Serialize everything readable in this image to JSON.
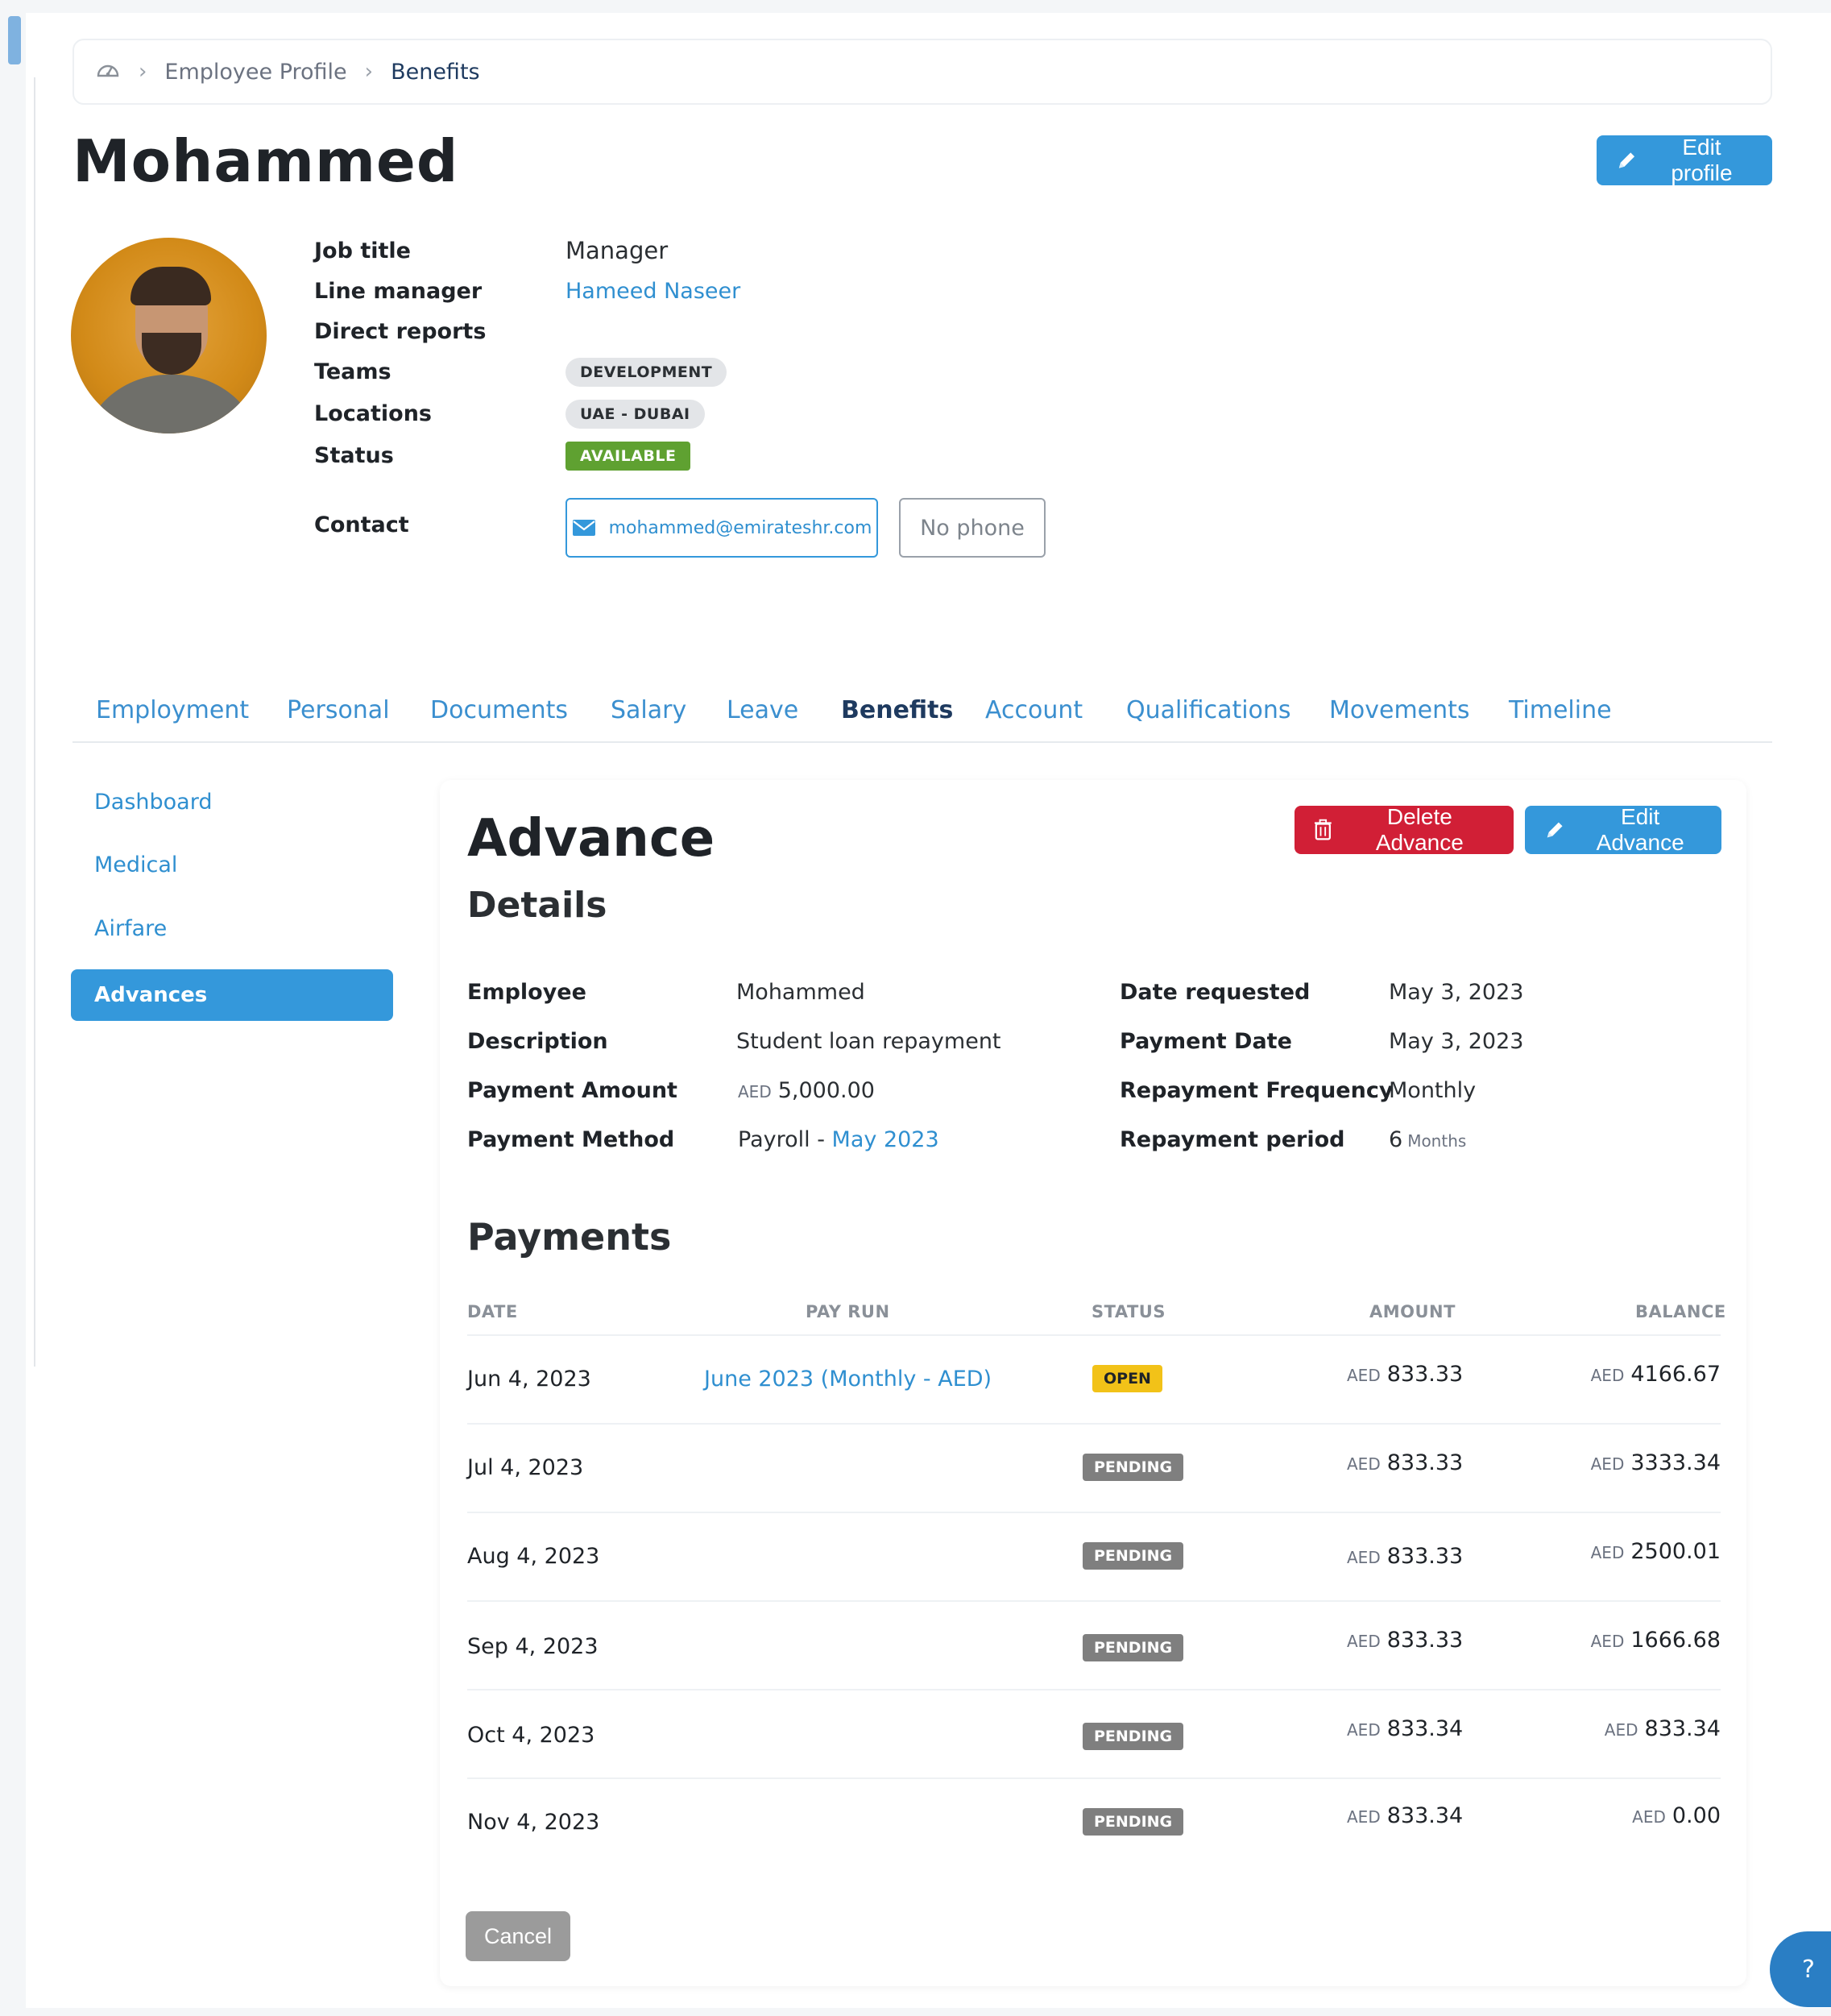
{
  "breadcrumb": {
    "items": [
      "Employee Profile",
      "Benefits"
    ]
  },
  "profile": {
    "name": "Mohammed",
    "edit_profile_label": "Edit profile",
    "fields": {
      "job_title_label": "Job title",
      "job_title": "Manager",
      "line_manager_label": "Line manager",
      "line_manager": "Hameed Naseer",
      "direct_reports_label": "Direct reports",
      "teams_label": "Teams",
      "team": "DEVELOPMENT",
      "locations_label": "Locations",
      "location": "UAE - DUBAI",
      "status_label": "Status",
      "status": "AVAILABLE",
      "contact_label": "Contact",
      "email": "mohammed@emirateshr.com",
      "phone": "No phone"
    }
  },
  "tabs": [
    "Employment",
    "Personal",
    "Documents",
    "Salary",
    "Leave",
    "Benefits",
    "Account",
    "Qualifications",
    "Movements",
    "Timeline"
  ],
  "active_tab": "Benefits",
  "side_menu": [
    "Dashboard",
    "Medical",
    "Airfare",
    "Advances"
  ],
  "advance": {
    "title": "Advance",
    "subtitle": "Details",
    "delete_label": "Delete Advance",
    "edit_label": "Edit Advance",
    "details": {
      "employee_label": "Employee",
      "employee": "Mohammed",
      "description_label": "Description",
      "description": "Student loan repayment",
      "payment_amount_label": "Payment Amount",
      "currency": "AED",
      "payment_amount": "5,000.00",
      "payment_method_label": "Payment Method",
      "payment_method": "Payroll -",
      "payment_method_link": "May 2023",
      "date_requested_label": "Date requested",
      "date_requested": "May 3, 2023",
      "payment_date_label": "Payment Date",
      "payment_date": "May 3, 2023",
      "repayment_frequency_label": "Repayment Frequency",
      "repayment_frequency": "Monthly",
      "repayment_period_label": "Repayment period",
      "repayment_period": "6",
      "repayment_period_unit": "Months"
    },
    "payments_title": "Payments",
    "columns": [
      "DATE",
      "PAY RUN",
      "STATUS",
      "AMOUNT",
      "BALANCE"
    ],
    "rows": [
      {
        "date": "Jun 4, 2023",
        "pay_run": "June 2023 (Monthly - AED)",
        "status": "OPEN",
        "amount": "833.33",
        "balance": "4166.67"
      },
      {
        "date": "Jul 4, 2023",
        "pay_run": "",
        "status": "PENDING",
        "amount": "833.33",
        "balance": "3333.34"
      },
      {
        "date": "Aug 4, 2023",
        "pay_run": "",
        "status": "PENDING",
        "amount": "833.33",
        "balance": "2500.01"
      },
      {
        "date": "Sep 4, 2023",
        "pay_run": "",
        "status": "PENDING",
        "amount": "833.33",
        "balance": "1666.68"
      },
      {
        "date": "Oct 4, 2023",
        "pay_run": "",
        "status": "PENDING",
        "amount": "833.34",
        "balance": "833.34"
      },
      {
        "date": "Nov 4, 2023",
        "pay_run": "",
        "status": "PENDING",
        "amount": "833.34",
        "balance": "0.00"
      }
    ],
    "cancel_label": "Cancel"
  },
  "help_label": "?"
}
